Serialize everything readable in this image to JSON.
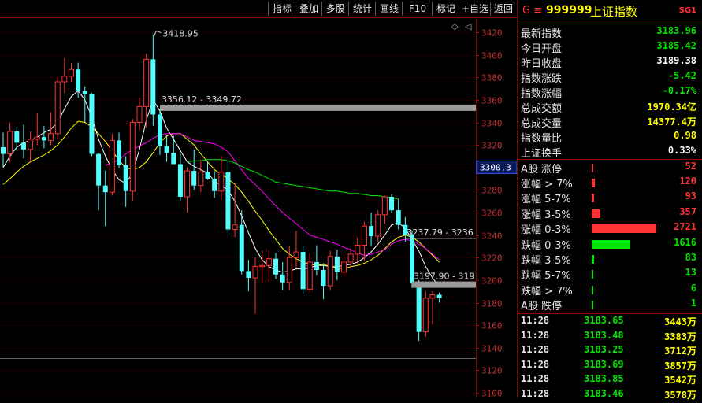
{
  "toolbar": {
    "buttons": [
      "指标",
      "叠加",
      "多股",
      "统计",
      "画线",
      "F10",
      "标记",
      "+自选",
      "返回"
    ]
  },
  "header": {
    "prefix": "G ≡",
    "code": "999999",
    "name": "上证指数",
    "badge": "SG1"
  },
  "quote": [
    {
      "label": "最新指数",
      "value": "3183.96",
      "color": "#00e600"
    },
    {
      "label": "今日开盘",
      "value": "3185.42",
      "color": "#00e600"
    },
    {
      "label": "昨日收盘",
      "value": "3189.38",
      "color": "#ffffff"
    },
    {
      "label": "指数涨跌",
      "value": "-5.42",
      "color": "#00e600"
    },
    {
      "label": "指数涨幅",
      "value": "-0.17%",
      "color": "#00e600"
    },
    {
      "label": "总成交额",
      "value": "1970.34亿",
      "color": "#ffff00"
    },
    {
      "label": "总成交量",
      "value": "14377.4万",
      "color": "#ffff00"
    },
    {
      "label": "指数量比",
      "value": "0.98",
      "color": "#ffff00"
    },
    {
      "label": "上证换手",
      "value": "0.33%",
      "color": "#ffffff"
    }
  ],
  "breadth": [
    {
      "label": "A股 涨停",
      "value": "52",
      "color": "#ff3333",
      "count": 52,
      "max": 2721
    },
    {
      "label": "涨幅 > 7%",
      "value": "120",
      "color": "#ff3333",
      "count": 120,
      "max": 2721
    },
    {
      "label": "涨幅 5-7%",
      "value": "93",
      "color": "#ff3333",
      "count": 93,
      "max": 2721
    },
    {
      "label": "涨幅 3-5%",
      "value": "357",
      "color": "#ff3333",
      "count": 357,
      "max": 2721
    },
    {
      "label": "涨幅 0-3%",
      "value": "2721",
      "color": "#ff3333",
      "count": 2721,
      "max": 2721
    },
    {
      "label": "跌幅 0-3%",
      "value": "1616",
      "color": "#00e600",
      "count": 1616,
      "max": 2721
    },
    {
      "label": "跌幅 3-5%",
      "value": "83",
      "color": "#00e600",
      "count": 83,
      "max": 2721
    },
    {
      "label": "跌幅 5-7%",
      "value": "13",
      "color": "#00e600",
      "count": 13,
      "max": 2721
    },
    {
      "label": "跌幅 > 7%",
      "value": "6",
      "color": "#00e600",
      "count": 6,
      "max": 2721
    },
    {
      "label": "A股 跌停",
      "value": "1",
      "color": "#00e600",
      "count": 1,
      "max": 2721
    }
  ],
  "ticks": [
    {
      "time": "11:28",
      "price": "3183.65",
      "vol": "3443万"
    },
    {
      "time": "11:28",
      "price": "3183.48",
      "vol": "3383万"
    },
    {
      "time": "11:28",
      "price": "3183.25",
      "vol": "3712万"
    },
    {
      "time": "11:28",
      "price": "3183.69",
      "vol": "3857万"
    },
    {
      "time": "11:28",
      "price": "3183.85",
      "vol": "3542万"
    },
    {
      "time": "11:28",
      "price": "3183.46",
      "vol": "3578万"
    }
  ],
  "chart_data": {
    "type": "candlestick",
    "ylim": [
      3100,
      3425
    ],
    "y_ticks": [
      3100,
      3120,
      3140,
      3160,
      3180,
      3200,
      3220,
      3240,
      3260,
      3280,
      3300,
      3320,
      3340,
      3360,
      3380,
      3400,
      3420
    ],
    "current_price_label": "3300.3",
    "current_price_value": 3300.3,
    "candles": [
      {
        "o": 3318,
        "h": 3331,
        "l": 3300,
        "c": 3312
      },
      {
        "o": 3312,
        "h": 3340,
        "l": 3305,
        "c": 3332
      },
      {
        "o": 3332,
        "h": 3336,
        "l": 3315,
        "c": 3322
      },
      {
        "o": 3322,
        "h": 3338,
        "l": 3308,
        "c": 3316
      },
      {
        "o": 3316,
        "h": 3332,
        "l": 3305,
        "c": 3325
      },
      {
        "o": 3325,
        "h": 3348,
        "l": 3320,
        "c": 3327
      },
      {
        "o": 3327,
        "h": 3337,
        "l": 3317,
        "c": 3324
      },
      {
        "o": 3324,
        "h": 3349,
        "l": 3320,
        "c": 3330
      },
      {
        "o": 3330,
        "h": 3380,
        "l": 3325,
        "c": 3376
      },
      {
        "o": 3376,
        "h": 3397,
        "l": 3366,
        "c": 3381
      },
      {
        "o": 3381,
        "h": 3393,
        "l": 3376,
        "c": 3387
      },
      {
        "o": 3387,
        "h": 3393,
        "l": 3362,
        "c": 3368
      },
      {
        "o": 3368,
        "h": 3372,
        "l": 3340,
        "c": 3365
      },
      {
        "o": 3365,
        "h": 3366,
        "l": 3310,
        "c": 3312
      },
      {
        "o": 3312,
        "h": 3313,
        "l": 3262,
        "c": 3284
      },
      {
        "o": 3284,
        "h": 3297,
        "l": 3248,
        "c": 3278
      },
      {
        "o": 3278,
        "h": 3330,
        "l": 3275,
        "c": 3324
      },
      {
        "o": 3324,
        "h": 3331,
        "l": 3299,
        "c": 3302
      },
      {
        "o": 3302,
        "h": 3310,
        "l": 3265,
        "c": 3279
      },
      {
        "o": 3279,
        "h": 3343,
        "l": 3270,
        "c": 3340
      },
      {
        "o": 3340,
        "h": 3362,
        "l": 3333,
        "c": 3354
      },
      {
        "o": 3354,
        "h": 3401,
        "l": 3335,
        "c": 3396
      },
      {
        "o": 3396,
        "h": 3418,
        "l": 3337,
        "c": 3347
      },
      {
        "o": 3347,
        "h": 3352,
        "l": 3311,
        "c": 3319
      },
      {
        "o": 3319,
        "h": 3328,
        "l": 3305,
        "c": 3313
      },
      {
        "o": 3313,
        "h": 3328,
        "l": 3303,
        "c": 3303
      },
      {
        "o": 3303,
        "h": 3312,
        "l": 3270,
        "c": 3274
      },
      {
        "o": 3274,
        "h": 3300,
        "l": 3260,
        "c": 3297
      },
      {
        "o": 3297,
        "h": 3316,
        "l": 3280,
        "c": 3284
      },
      {
        "o": 3284,
        "h": 3307,
        "l": 3278,
        "c": 3296
      },
      {
        "o": 3296,
        "h": 3306,
        "l": 3289,
        "c": 3290
      },
      {
        "o": 3290,
        "h": 3297,
        "l": 3273,
        "c": 3279
      },
      {
        "o": 3279,
        "h": 3310,
        "l": 3271,
        "c": 3296
      },
      {
        "o": 3296,
        "h": 3306,
        "l": 3240,
        "c": 3245
      },
      {
        "o": 3245,
        "h": 3286,
        "l": 3238,
        "c": 3249
      },
      {
        "o": 3249,
        "h": 3262,
        "l": 3205,
        "c": 3208
      },
      {
        "o": 3208,
        "h": 3218,
        "l": 3190,
        "c": 3202
      },
      {
        "o": 3202,
        "h": 3220,
        "l": 3170,
        "c": 3212
      },
      {
        "o": 3212,
        "h": 3226,
        "l": 3197,
        "c": 3213
      },
      {
        "o": 3213,
        "h": 3227,
        "l": 3198,
        "c": 3219
      },
      {
        "o": 3219,
        "h": 3224,
        "l": 3201,
        "c": 3205
      },
      {
        "o": 3205,
        "h": 3216,
        "l": 3191,
        "c": 3198
      },
      {
        "o": 3198,
        "h": 3230,
        "l": 3191,
        "c": 3220
      },
      {
        "o": 3220,
        "h": 3244,
        "l": 3211,
        "c": 3225
      },
      {
        "o": 3225,
        "h": 3230,
        "l": 3188,
        "c": 3192
      },
      {
        "o": 3192,
        "h": 3224,
        "l": 3189,
        "c": 3216
      },
      {
        "o": 3216,
        "h": 3231,
        "l": 3204,
        "c": 3209
      },
      {
        "o": 3209,
        "h": 3215,
        "l": 3183,
        "c": 3195
      },
      {
        "o": 3195,
        "h": 3226,
        "l": 3191,
        "c": 3221
      },
      {
        "o": 3221,
        "h": 3227,
        "l": 3200,
        "c": 3207
      },
      {
        "o": 3207,
        "h": 3223,
        "l": 3203,
        "c": 3216
      },
      {
        "o": 3216,
        "h": 3228,
        "l": 3210,
        "c": 3223
      },
      {
        "o": 3223,
        "h": 3238,
        "l": 3214,
        "c": 3231
      },
      {
        "o": 3231,
        "h": 3252,
        "l": 3217,
        "c": 3248
      },
      {
        "o": 3248,
        "h": 3260,
        "l": 3230,
        "c": 3239
      },
      {
        "o": 3239,
        "h": 3262,
        "l": 3234,
        "c": 3258
      },
      {
        "o": 3258,
        "h": 3275,
        "l": 3250,
        "c": 3274
      },
      {
        "o": 3274,
        "h": 3276,
        "l": 3260,
        "c": 3262
      },
      {
        "o": 3262,
        "h": 3272,
        "l": 3245,
        "c": 3249
      },
      {
        "o": 3249,
        "h": 3256,
        "l": 3234,
        "c": 3240
      },
      {
        "o": 3240,
        "h": 3244,
        "l": 3193,
        "c": 3197
      },
      {
        "o": 3197,
        "h": 3200,
        "l": 3146,
        "c": 3154
      },
      {
        "o": 3154,
        "h": 3190,
        "l": 3150,
        "c": 3184
      },
      {
        "o": 3184,
        "h": 3190,
        "l": 3161,
        "c": 3187
      },
      {
        "o": 3187,
        "h": 3189,
        "l": 3180,
        "c": 3184
      }
    ],
    "ma_series": [
      {
        "color": "#ffffff",
        "values": [
          3300,
          3310,
          3318,
          3322,
          3324,
          3327,
          3331,
          3334,
          3340,
          3352,
          3363,
          3368,
          3360,
          3345,
          3325,
          3310,
          3298,
          3289,
          3286,
          3295,
          3316,
          3342,
          3360,
          3350,
          3335,
          3325,
          3315,
          3305,
          3301,
          3298,
          3295,
          3288,
          3284,
          3280,
          3270,
          3257,
          3242,
          3228,
          3218,
          3212,
          3209,
          3207,
          3208,
          3210,
          3210,
          3211,
          3213,
          3213,
          3212,
          3212,
          3213,
          3214,
          3216,
          3220,
          3225,
          3232,
          3240,
          3249,
          3251,
          3246,
          3236,
          3226,
          3212,
          3202,
          3194
        ]
      },
      {
        "color": "#ffff00",
        "values": [
          3285,
          3290,
          3296,
          3301,
          3305,
          3308,
          3311,
          3315,
          3320,
          3327,
          3335,
          3341,
          3340,
          3336,
          3330,
          3323,
          3315,
          3306,
          3300,
          3298,
          3300,
          3305,
          3313,
          3322,
          3328,
          3330,
          3330,
          3325,
          3320,
          3312,
          3305,
          3298,
          3294,
          3290,
          3285,
          3278,
          3270,
          3261,
          3253,
          3244,
          3236,
          3228,
          3223,
          3219,
          3216,
          3214,
          3213,
          3214,
          3212,
          3211,
          3210,
          3212,
          3213,
          3215,
          3218,
          3222,
          3228,
          3234,
          3238,
          3240,
          3238,
          3234,
          3228,
          3222,
          3216
        ]
      },
      {
        "color": "#ff00ff",
        "values": [
          null,
          null,
          null,
          null,
          null,
          null,
          null,
          null,
          null,
          null,
          null,
          null,
          null,
          null,
          null,
          3302,
          3304,
          3307,
          3312,
          3316,
          3319,
          3322,
          3326,
          3329,
          3330,
          3330,
          3330,
          3327,
          3324,
          3323,
          3322,
          3321,
          3318,
          3314,
          3306,
          3298,
          3290,
          3285,
          3279,
          3272,
          3266,
          3260,
          3255,
          3250,
          3245,
          3240,
          3238,
          3236,
          3234,
          3232,
          3229,
          3227,
          3224,
          3222,
          3223,
          3225,
          3227,
          3232,
          3235,
          3236,
          3235,
          3232,
          3228,
          3223,
          3218
        ]
      },
      {
        "color": "#00e600",
        "values": [
          null,
          null,
          null,
          null,
          null,
          null,
          null,
          null,
          null,
          null,
          null,
          null,
          null,
          null,
          null,
          null,
          null,
          null,
          null,
          null,
          null,
          null,
          null,
          null,
          null,
          null,
          null,
          3305,
          3306,
          3306,
          3307,
          3307,
          3307,
          3306,
          3304,
          3301,
          3298,
          3296,
          3293,
          3290,
          3287,
          3286,
          3285,
          3284,
          3283,
          3282,
          3281,
          3280,
          3279,
          3279,
          3278,
          3277,
          3277,
          3276,
          3275,
          3275,
          3274,
          3273,
          3272,
          null,
          null,
          null,
          null,
          null,
          null
        ]
      }
    ],
    "annotations": [
      {
        "text": "3418.95",
        "candle": 22,
        "y": 3418.95,
        "type": "peak"
      },
      {
        "text": "3356.12 - 3349.72",
        "candle": 23,
        "y": 3353,
        "low": 3349.72,
        "high": 3356.12,
        "type": "band",
        "to_right": true
      },
      {
        "text": "3237.79 - 3236",
        "candle": 59,
        "y": 3237,
        "type": "line",
        "to_right": true
      },
      {
        "text": "3197.90 - 319",
        "candle": 60,
        "y": 3196,
        "type": "band",
        "to_right": true
      }
    ]
  }
}
